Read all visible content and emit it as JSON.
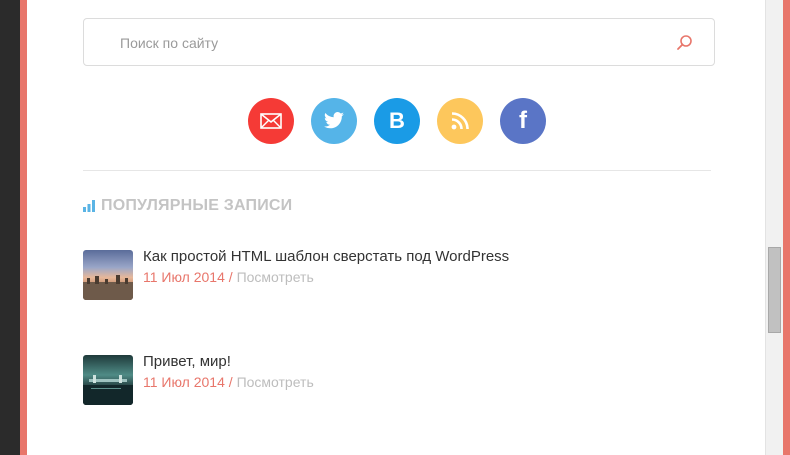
{
  "search": {
    "placeholder": "Поиск по сайту"
  },
  "social": [
    {
      "name": "email",
      "icon": "envelope-icon",
      "color": "#f53a36"
    },
    {
      "name": "twitter",
      "icon": "twitter-bird-icon",
      "color": "#55b4e8"
    },
    {
      "name": "vkontakte",
      "icon": "vk-icon",
      "glyph": "В",
      "color": "#1a9be6"
    },
    {
      "name": "rss",
      "icon": "rss-icon",
      "color": "#fdc75c"
    },
    {
      "name": "facebook",
      "icon": "facebook-icon",
      "glyph": "f",
      "color": "#5a75c6"
    }
  ],
  "popular": {
    "title": "ПОПУЛЯРНЫЕ ЗАПИСИ",
    "title_icon": "bar-chart-icon",
    "posts": [
      {
        "title": "Как простой HTML шаблон сверстать под WordPress",
        "date": "11 Июл 2014",
        "separator": " / ",
        "view": "Посмотреть"
      },
      {
        "title": "Привет, мир!",
        "date": "11 Июл 2014",
        "separator": " / ",
        "view": "Посмотреть"
      }
    ]
  },
  "colors": {
    "accent": "#e8766b",
    "muted": "#c4c4c4",
    "chart_icon": "#5ab4e5"
  }
}
